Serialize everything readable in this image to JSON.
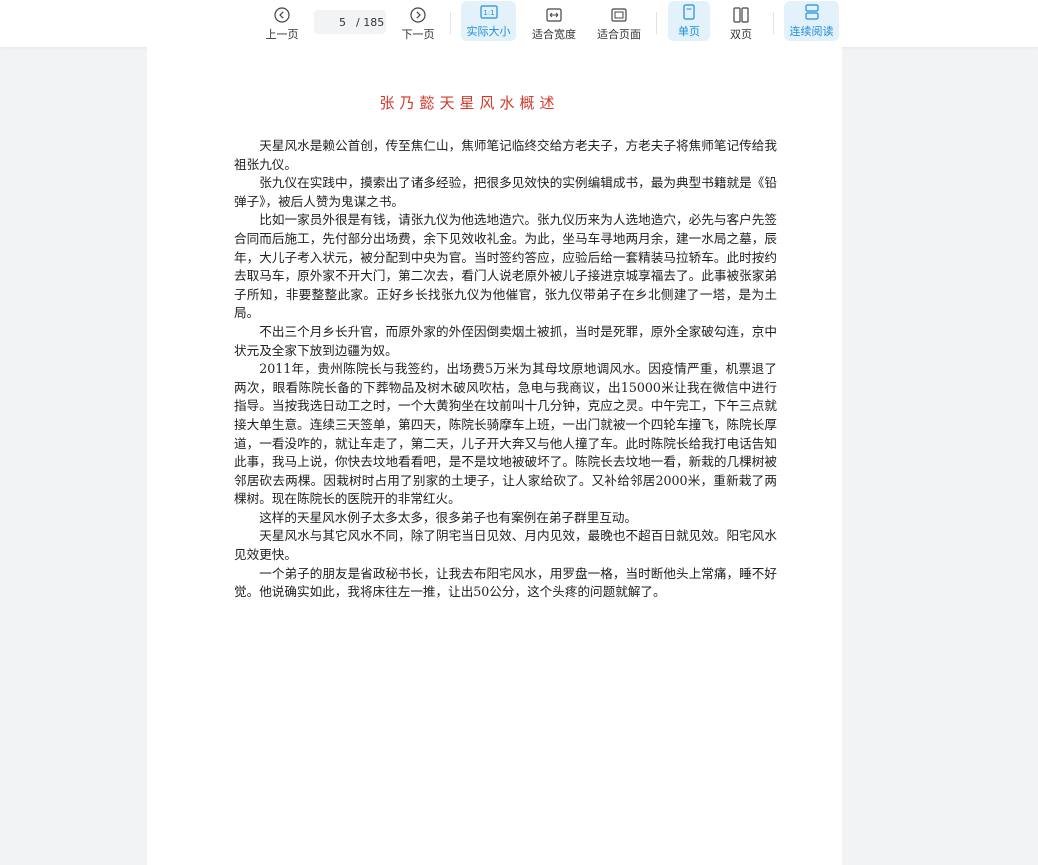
{
  "toolbar": {
    "prev_label": "上一页",
    "current_page": "5",
    "total_pages": "/ 185",
    "next_label": "下一页",
    "actual_size_label": "实际大小",
    "fit_width_label": "适合宽度",
    "fit_page_label": "适合页面",
    "single_page_label": "单页",
    "double_page_label": "双页",
    "continuous_label": "连续阅读",
    "accent_color": "#1f8fd6"
  },
  "document": {
    "title": "张乃懿天星风水概述",
    "paragraphs": [
      "天星风水是赖公首创，传至焦仁山，焦师笔记临终交给方老夫子，方老夫子将焦师笔记传给我祖张九仪。",
      "张九仪在实践中，摸索出了诸多经验，把很多见效快的实例编辑成书，最为典型书籍就是《铅弹子》，被后人赞为鬼谋之书。",
      "比如一家员外很是有钱，请张九仪为他选地造穴。张九仪历来为人选地造穴，必先与客户先签合同而后施工，先付部分出场费，余下见效收礼金。为此，坐马车寻地两月余，建一水局之墓，辰年，大儿子考入状元，被分配到中央为官。当时签约答应，应验后给一套精装马拉轿车。此时按约去取马车，原外家不开大门，第二次去，看门人说老原外被儿子接进京城享福去了。此事被张家弟子所知，非要整整此家。正好乡长找张九仪为他催官，张九仪带弟子在乡北侧建了一塔，是为土局。",
      "不出三个月乡长升官，而原外家的外侄因倒卖烟土被抓，当时是死罪，原外全家破勾连，京中状元及全家下放到边疆为奴。",
      "2011年，贵州陈院长与我签约，出场费5万米为其母坟原地调风水。因疫情严重，机票退了两次，眼看陈院长备的下葬物品及树木破风吹枯，急电与我商议，出15000米让我在微信中进行指导。当按我选日动工之时，一个大黄狗坐在坟前叫十几分钟，克应之灵。中午完工，下午三点就接大单生意。连续三天签单，第四天，陈院长骑摩车上班，一出门就被一个四轮车撞飞，陈院长厚道，一看没咋的，就让车走了，第二天，儿子开大奔又与他人撞了车。此时陈院长给我打电话告知此事，我马上说，你快去坟地看看吧，是不是坟地被破坏了。陈院长去坟地一看，新栽的几棵树被邻居砍去两棵。因栽树时占用了别家的土埂子，让人家给砍了。又补给邻居2000米，重新栽了两棵树。现在陈院长的医院开的非常红火。",
      "这样的天星风水例子太多太多，很多弟子也有案例在弟子群里互动。",
      "天星风水与其它风水不同，除了阴宅当日见效、月内见效，最晚也不超百日就见效。阳宅风水见效更快。",
      "一个弟子的朋友是省政秘书长，让我去布阳宅风水，用罗盘一格，当时断他头上常痛，睡不好觉。他说确实如此，我将床往左一推，让出50公分，这个头疼的问题就解了。"
    ]
  }
}
